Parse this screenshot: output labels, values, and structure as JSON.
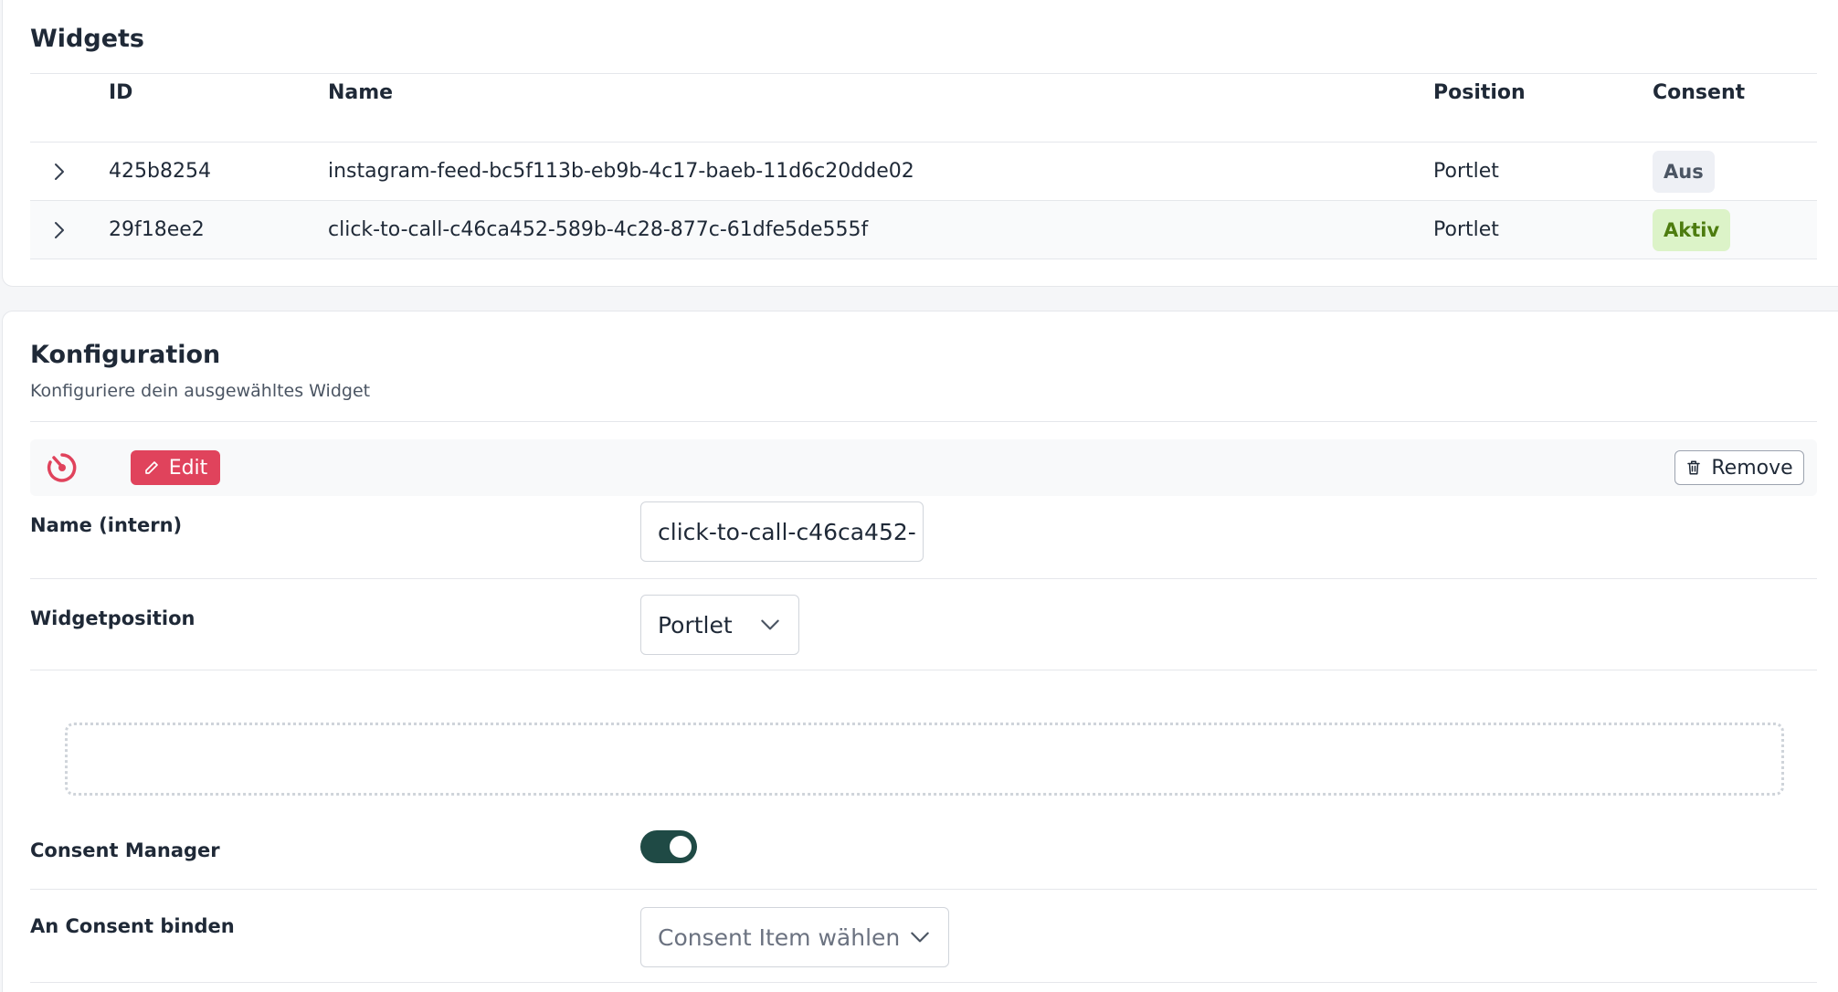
{
  "widgets": {
    "title": "Widgets",
    "columns": {
      "id": "ID",
      "name": "Name",
      "position": "Position",
      "consent": "Consent"
    },
    "rows": [
      {
        "id": "425b8254",
        "name": "instagram-feed-bc5f113b-eb9b-4c17-baeb-11d6c20dde02",
        "position": "Portlet",
        "consent": "Aus"
      },
      {
        "id": "29f18ee2",
        "name": "click-to-call-c46ca452-589b-4c28-877c-61dfe5de555f",
        "position": "Portlet",
        "consent": "Aktiv"
      }
    ]
  },
  "config": {
    "title": "Konfiguration",
    "subtitle": "Konfiguriere dein ausgewähltes Widget",
    "edit_label": "Edit",
    "remove_label": "Remove",
    "name_label": "Name (intern)",
    "name_value": "click-to-call-c46ca452-",
    "position_label": "Widgetposition",
    "position_value": "Portlet",
    "consent_manager_label": "Consent Manager",
    "consent_manager_on": true,
    "consent_bind_label": "An Consent binden",
    "consent_bind_placeholder": "Consent Item wählen"
  },
  "colors": {
    "accent_edit": "#e0435c",
    "toggle_on": "#1f4a45",
    "badge_active_bg": "#dcf3c8",
    "badge_inactive_bg": "#eef0f5"
  },
  "icons": [
    "chevron-right-icon",
    "brand-logo-icon",
    "pencil-icon",
    "trash-icon",
    "chevron-down-icon"
  ]
}
